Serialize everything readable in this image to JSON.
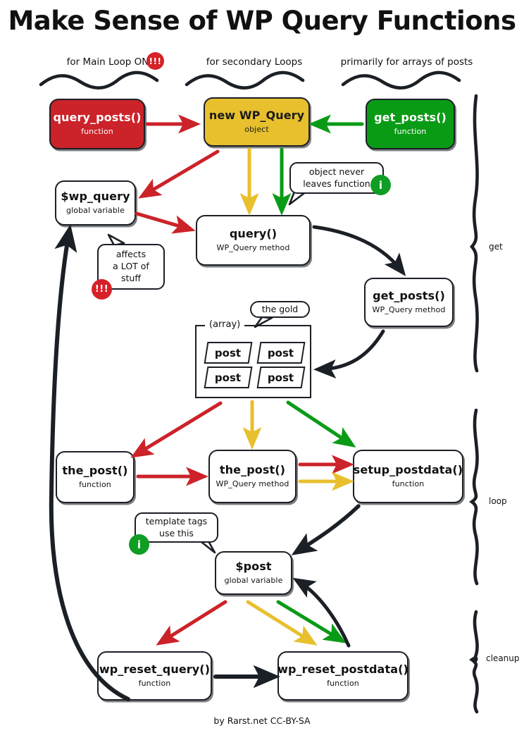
{
  "title": "Make Sense of WP Query Functions",
  "credit": "by Rarst.net CC-BY-SA",
  "column_headers": [
    {
      "id": "main-loop",
      "text": "for Main Loop ONLY",
      "badge": "!!!"
    },
    {
      "id": "secondary-loops",
      "text": "for secondary Loops",
      "badge": ""
    },
    {
      "id": "arrays-of-posts",
      "text": "primarily for arrays of posts",
      "badge": ""
    }
  ],
  "stage_braces": [
    {
      "id": "get",
      "label": "get"
    },
    {
      "id": "loop",
      "label": "loop"
    },
    {
      "id": "cleanup",
      "label": "cleanup"
    }
  ],
  "nodes": [
    {
      "id": "query-posts",
      "name": "query_posts()",
      "sub": "function",
      "color": "red"
    },
    {
      "id": "new-wp-query",
      "name": "new WP_Query",
      "sub": "object",
      "color": "gold"
    },
    {
      "id": "get-posts-fn",
      "name": "get_posts()",
      "sub": "function",
      "color": "green"
    },
    {
      "id": "wp-query-global",
      "name": "$wp_query",
      "sub": "global variable",
      "color": "white"
    },
    {
      "id": "query-method",
      "name": "query()",
      "sub": "WP_Query method",
      "color": "white"
    },
    {
      "id": "get-posts-method",
      "name": "get_posts()",
      "sub": "WP_Query method",
      "color": "white"
    },
    {
      "id": "the-post-fn",
      "name": "the_post()",
      "sub": "function",
      "color": "white"
    },
    {
      "id": "the-post-method",
      "name": "the_post()",
      "sub": "WP_Query method",
      "color": "white"
    },
    {
      "id": "setup-postdata",
      "name": "setup_postdata()",
      "sub": "function",
      "color": "white"
    },
    {
      "id": "post-global",
      "name": "$post",
      "sub": "global variable",
      "color": "white"
    },
    {
      "id": "wp-reset-query",
      "name": "wp_reset_query()",
      "sub": "function",
      "color": "white"
    },
    {
      "id": "wp-reset-postdata",
      "name": "wp_reset_postdata()",
      "sub": "function",
      "color": "white"
    }
  ],
  "array_block": {
    "label": "(array)",
    "items": [
      "post",
      "post",
      "post",
      "post"
    ]
  },
  "bubbles": [
    {
      "id": "object-never-leaves",
      "lines": [
        "object never",
        "leaves function"
      ],
      "badge": "i",
      "badge_kind": "info"
    },
    {
      "id": "affects-a-lot",
      "lines": [
        "affects",
        "a LOT of",
        "stuff"
      ],
      "badge": "!!!",
      "badge_kind": "warn"
    },
    {
      "id": "the-gold",
      "lines": [
        "the gold"
      ],
      "badge": "",
      "badge_kind": ""
    },
    {
      "id": "template-tags",
      "lines": [
        "template tags",
        "use this"
      ],
      "badge": "i",
      "badge_kind": "info"
    }
  ],
  "colors": {
    "red": "#cc2229",
    "gold": "#e8c02e",
    "green": "#0a9b16",
    "ink": "#1b1f26",
    "paper": "#ffffff"
  }
}
